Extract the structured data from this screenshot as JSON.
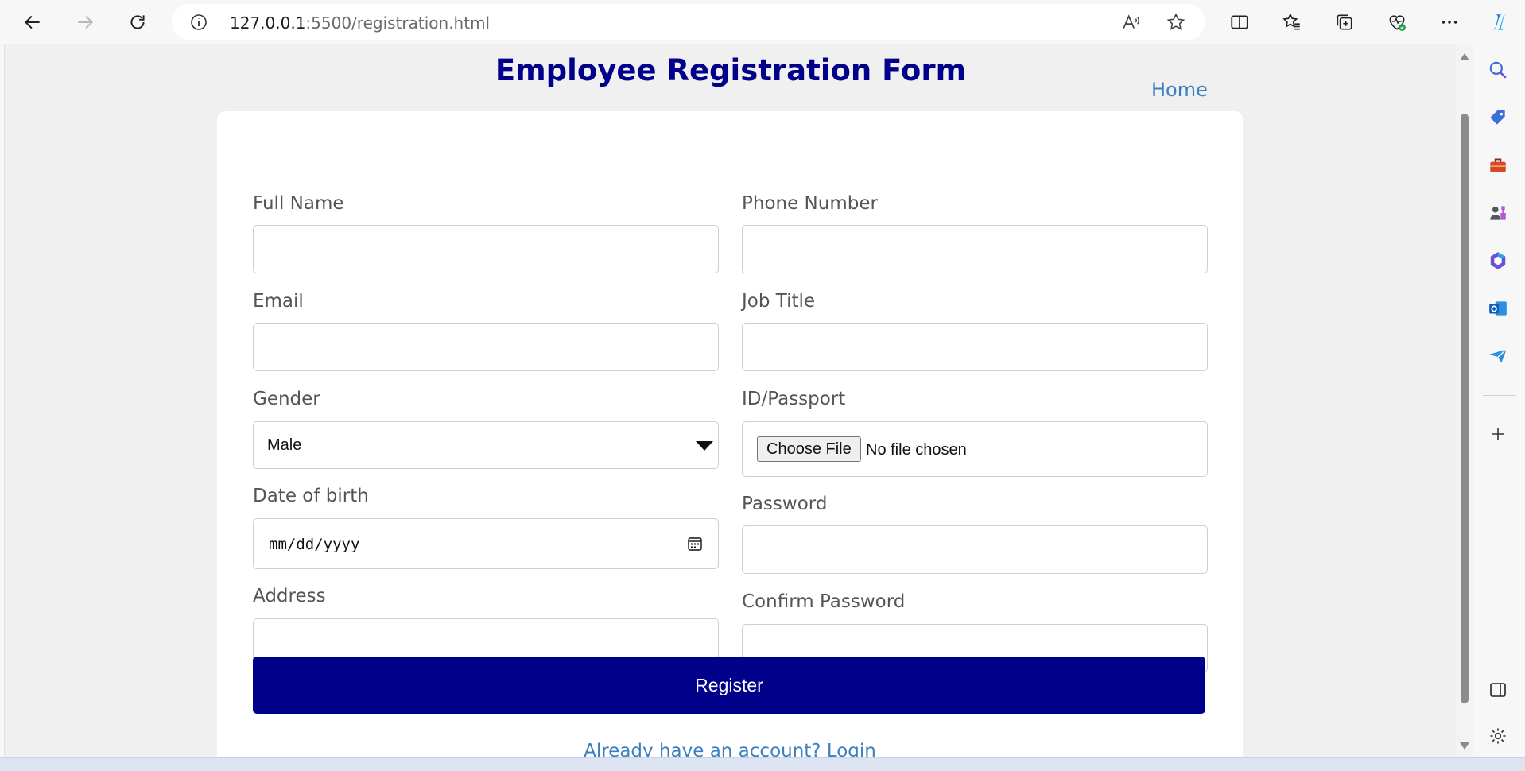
{
  "browser": {
    "url_host": "127.0.0.1",
    "url_path": ":5500/registration.html"
  },
  "page": {
    "title": "Employee Registration Form",
    "home_link": "Home"
  },
  "form": {
    "full_name_label": "Full Name",
    "phone_label": "Phone Number",
    "email_label": "Email",
    "job_title_label": "Job Title",
    "gender_label": "Gender",
    "gender_value": "Male",
    "id_passport_label": "ID/Passport",
    "choose_file_label": "Choose File",
    "no_file_text": "No file chosen",
    "dob_label": "Date of birth",
    "dob_placeholder": "mm/dd/yyyy",
    "password_label": "Password",
    "address_label": "Address",
    "confirm_password_label": "Confirm Password",
    "register_label": "Register",
    "login_link": "Already have an account? Login"
  },
  "colors": {
    "title": "#00008b",
    "register_button": "#00008b",
    "link": "#3a7fc1"
  },
  "icons": {
    "toolbar": [
      "back-arrow-icon",
      "forward-arrow-icon",
      "refresh-icon",
      "info-icon",
      "read-aloud-icon",
      "favorite-star-icon",
      "split-screen-icon",
      "favorites-icon",
      "collections-icon",
      "browser-essentials-icon",
      "more-icon",
      "copilot-icon"
    ],
    "sidebar": [
      "search-icon",
      "shopping-tag-icon",
      "tools-icon",
      "games-icon",
      "microsoft365-icon",
      "outlook-icon",
      "send-icon",
      "add-icon",
      "sidebar-toggle-icon",
      "settings-icon"
    ]
  }
}
